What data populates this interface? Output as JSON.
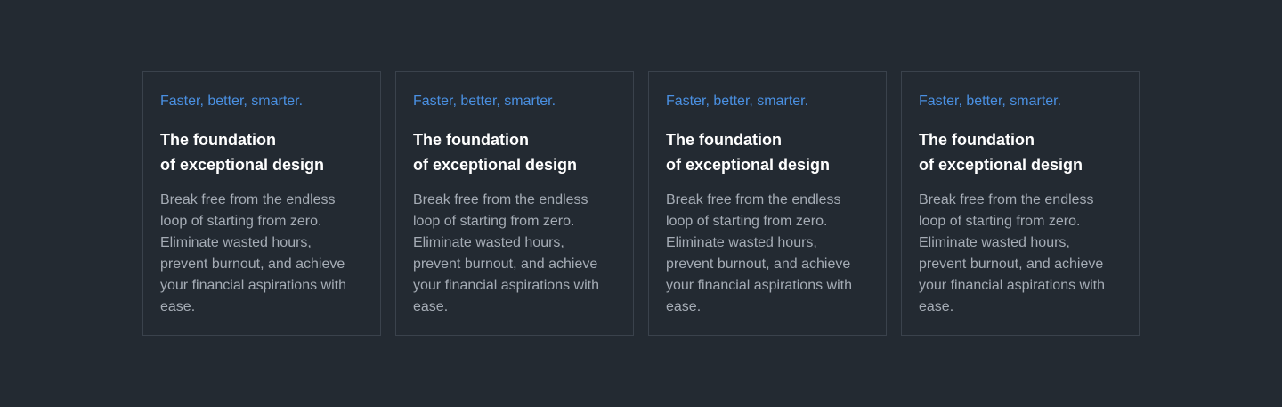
{
  "cards": [
    {
      "eyebrow": "Faster, better, smarter.",
      "title_line1": "The foundation",
      "title_line2": "of exceptional design",
      "body": "Break free from the endless loop of starting from zero. Eliminate wasted hours, prevent burnout, and achieve your financial aspirations with ease."
    },
    {
      "eyebrow": "Faster, better, smarter.",
      "title_line1": "The foundation",
      "title_line2": "of exceptional design",
      "body": "Break free from the endless loop of starting from zero. Eliminate wasted hours, prevent burnout, and achieve your financial aspirations with ease."
    },
    {
      "eyebrow": "Faster, better, smarter.",
      "title_line1": "The foundation",
      "title_line2": "of exceptional design",
      "body": "Break free from the endless loop of starting from zero. Eliminate wasted hours, prevent burnout, and achieve your financial aspirations with ease."
    },
    {
      "eyebrow": "Faster, better, smarter.",
      "title_line1": "The foundation",
      "title_line2": "of exceptional design",
      "body": "Break free from the endless loop of starting from zero. Eliminate wasted hours, prevent burnout, and achieve your financial aspirations with ease."
    }
  ],
  "colors": {
    "background": "#232a32",
    "accent": "#4a90e2",
    "title": "#ffffff",
    "body": "#a5acb5",
    "border": "#3a424c"
  }
}
